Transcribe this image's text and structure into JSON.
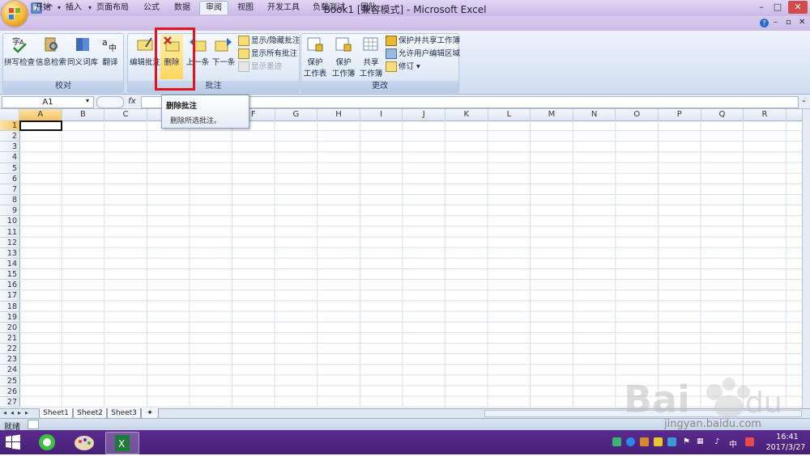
{
  "window": {
    "title": "Book1  [兼容模式] - Microsoft Excel",
    "min_glyph": "–",
    "max_glyph": "□",
    "close_glyph": "✕",
    "doc_min": "–",
    "doc_max": "▫",
    "doc_close": "✕"
  },
  "tabs": [
    "开始",
    "插入",
    "页面布局",
    "公式",
    "数据",
    "审阅",
    "视图",
    "开发工具",
    "负载测试",
    "团队"
  ],
  "active_tab": "审阅",
  "ribbon": {
    "proofing": {
      "label": "校对",
      "buttons": [
        "拼写检查",
        "信息检索",
        "同义词库",
        "翻译"
      ]
    },
    "comments": {
      "label": "批注",
      "edit": "编辑批注",
      "delete": "删除",
      "prev": "上一条",
      "next": "下一条",
      "show_hide": "显示/隐藏批注",
      "show_all": "显示所有批注",
      "show_ink": "显示墨迹"
    },
    "changes": {
      "label": "更改",
      "protect_sheet_1": "保护",
      "protect_sheet_2": "工作表",
      "protect_book_1": "保护",
      "protect_book_2": "工作簿",
      "share_1": "共享",
      "share_2": "工作簿",
      "protect_share": "保护并共享工作簿",
      "allow_edit": "允许用户编辑区域",
      "track": "修订"
    }
  },
  "formula_bar": {
    "name_box": "A1",
    "fx": "fx",
    "content": ""
  },
  "tooltip": {
    "title": "删除批注",
    "description": "删除所选批注。"
  },
  "columns": [
    "A",
    "B",
    "C",
    "D",
    "E",
    "F",
    "G",
    "H",
    "I",
    "J",
    "K",
    "L",
    "M",
    "N",
    "O",
    "P",
    "Q",
    "R"
  ],
  "rows": [
    "1",
    "2",
    "3",
    "4",
    "5",
    "6",
    "7",
    "8",
    "9",
    "10",
    "11",
    "12",
    "13",
    "14",
    "15",
    "16",
    "17",
    "18",
    "19",
    "20",
    "21",
    "22",
    "23",
    "24",
    "25",
    "26",
    "27"
  ],
  "sheets": [
    "Sheet1",
    "Sheet2",
    "Sheet3"
  ],
  "status": "就绪",
  "taskbar": {
    "time": "16:41",
    "date": "2017/3/27",
    "ime": "中"
  },
  "watermark": "jingyan.baidu.com",
  "colors": {
    "accent": "#e4141b",
    "titlebar": "#cbbce6",
    "taskbar": "#4b2380"
  }
}
